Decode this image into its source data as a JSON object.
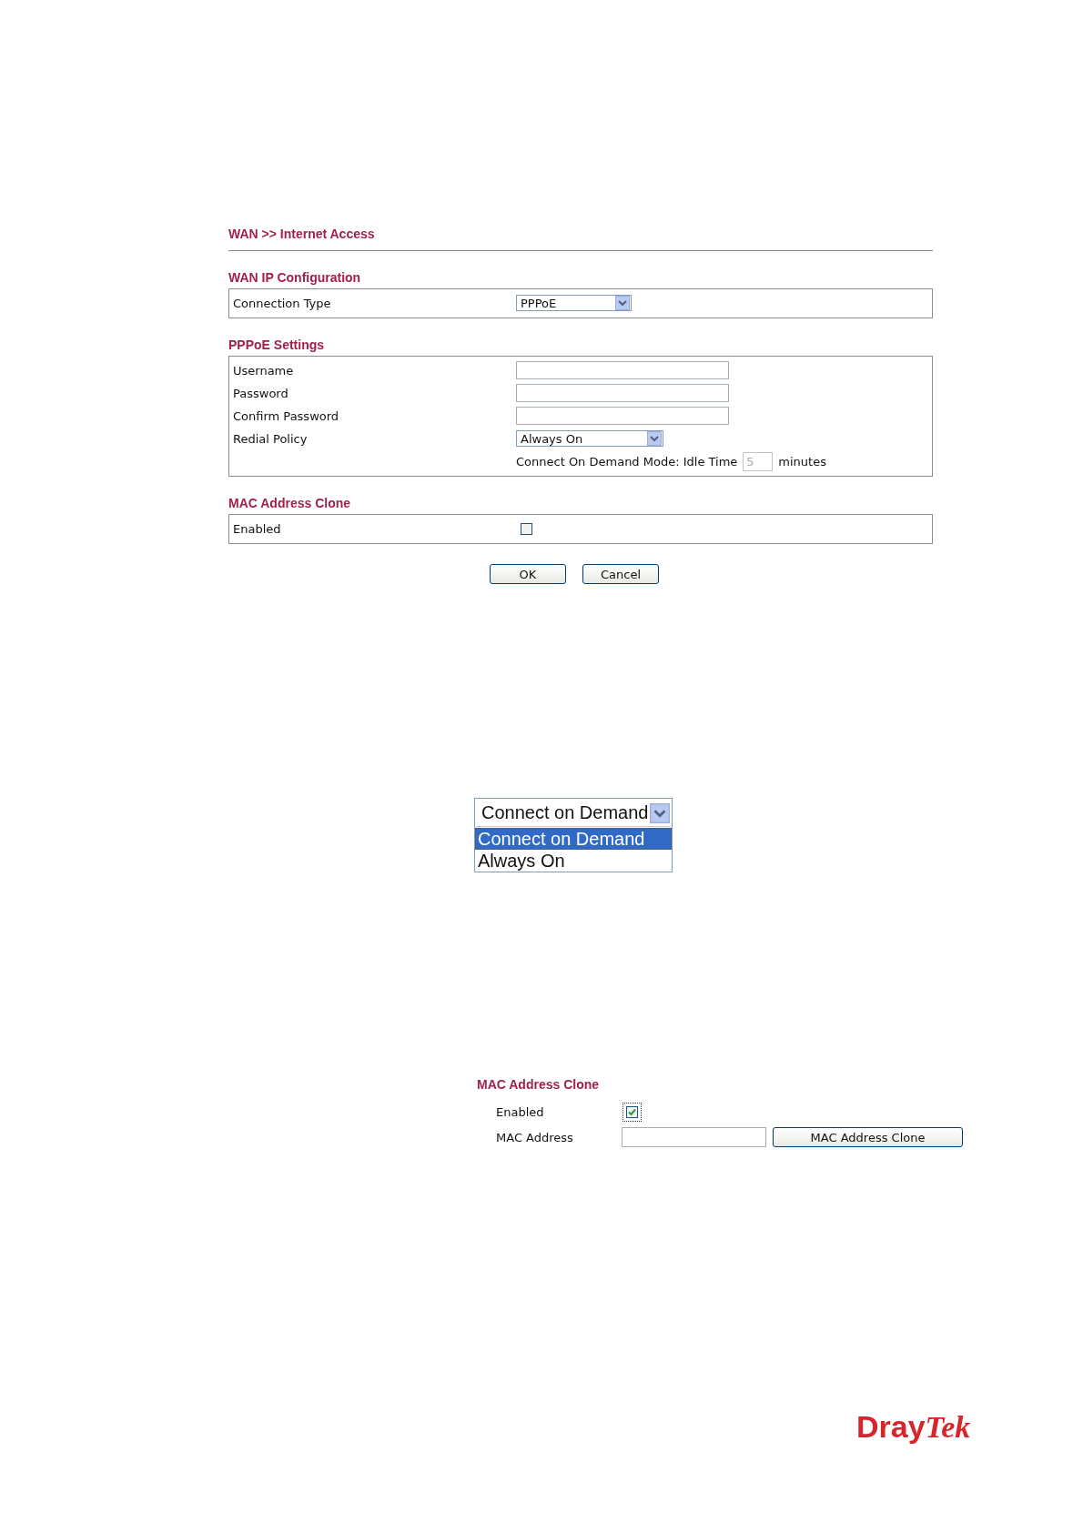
{
  "breadcrumb": "WAN >> Internet Access",
  "sections": [
    {
      "title": "WAN IP Configuration",
      "rows": [
        {
          "kind": "select",
          "label": "Connection Type",
          "value": "PPPoE"
        }
      ]
    },
    {
      "title": "PPPoE Settings",
      "rows": [
        {
          "kind": "text",
          "label": "Username"
        },
        {
          "kind": "text",
          "label": "Password"
        },
        {
          "kind": "text",
          "label": "Confirm Password"
        },
        {
          "kind": "select",
          "label": "Redial Policy",
          "value": "Always On"
        },
        {
          "kind": "idle",
          "prefix": "Connect On Demand Mode: Idle Time",
          "placeholder": "5",
          "suffix": "minutes"
        }
      ]
    },
    {
      "title": "MAC Address Clone",
      "rows": [
        {
          "kind": "checkbox",
          "label": "Enabled",
          "checked": false
        }
      ]
    }
  ],
  "buttons": [
    "OK",
    "Cancel"
  ],
  "redial_dropdown": {
    "value": "Connect on Demand",
    "options": [
      {
        "label": "Connect on Demand",
        "selected": true
      },
      {
        "label": "Always On",
        "selected": false
      }
    ]
  },
  "mac_clone_panel": {
    "title": "MAC Address Clone",
    "enabled": {
      "label": "Enabled",
      "checked": true
    },
    "mac_address": {
      "label": "MAC Address"
    },
    "button": "MAC Address Clone"
  },
  "logo": {
    "upright": "Dray",
    "italic": "Tek"
  }
}
